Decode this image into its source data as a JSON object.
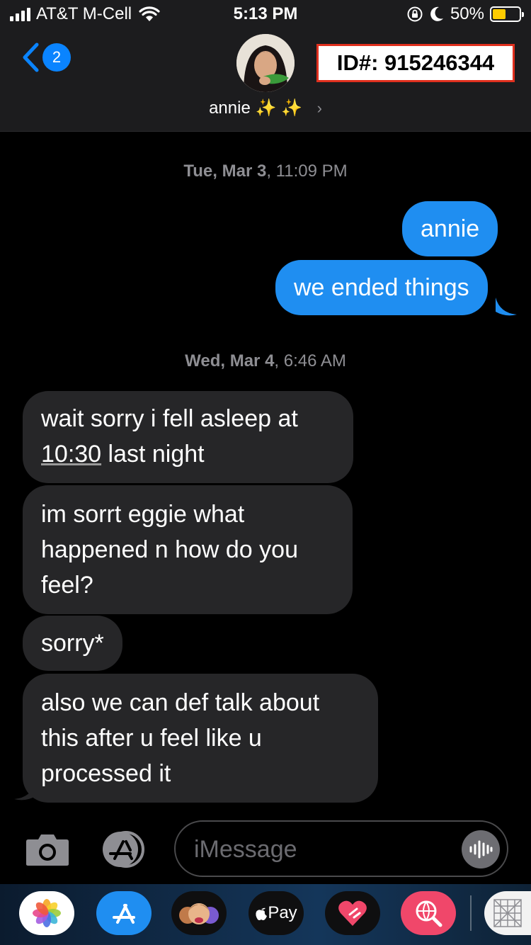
{
  "status_bar": {
    "carrier": "AT&T M-Cell",
    "time": "5:13 PM",
    "battery_percent": "50%",
    "battery_level": 0.5,
    "battery_color": "#ffcc00"
  },
  "header": {
    "back_count": "2",
    "contact_name": "annie ✨ ✨",
    "id_label": "ID#: 915246344"
  },
  "conversation": {
    "date1": {
      "day": "Tue, Mar 3",
      "time": "11:09 PM"
    },
    "sent": [
      {
        "text": "annie"
      },
      {
        "text": "we ended things"
      }
    ],
    "date2": {
      "day": "Wed, Mar 4",
      "time": "6:46 AM"
    },
    "received": [
      {
        "line1": "wait sorry i fell asleep at",
        "link": "10:30",
        "line2_rest": " last night"
      },
      {
        "line1": "im sorrt eggie what",
        "line2": "happened n how do you",
        "line3": "feel?"
      },
      {
        "line1": "sorry*"
      },
      {
        "line1": "also we can def talk about",
        "line2": "this after u feel like u",
        "line3": "processed it"
      }
    ]
  },
  "input": {
    "placeholder": "iMessage"
  },
  "app_drawer": {
    "apps": [
      "photos-app",
      "app-store-app",
      "memoji-app",
      "apple-pay-app",
      "digital-touch-app",
      "web-search-app",
      "more-app"
    ],
    "apple_pay_label": "Pay"
  },
  "colors": {
    "sent_bubble": "#1f8ef1",
    "received_bubble": "#262628",
    "accent": "#0a84ff"
  }
}
